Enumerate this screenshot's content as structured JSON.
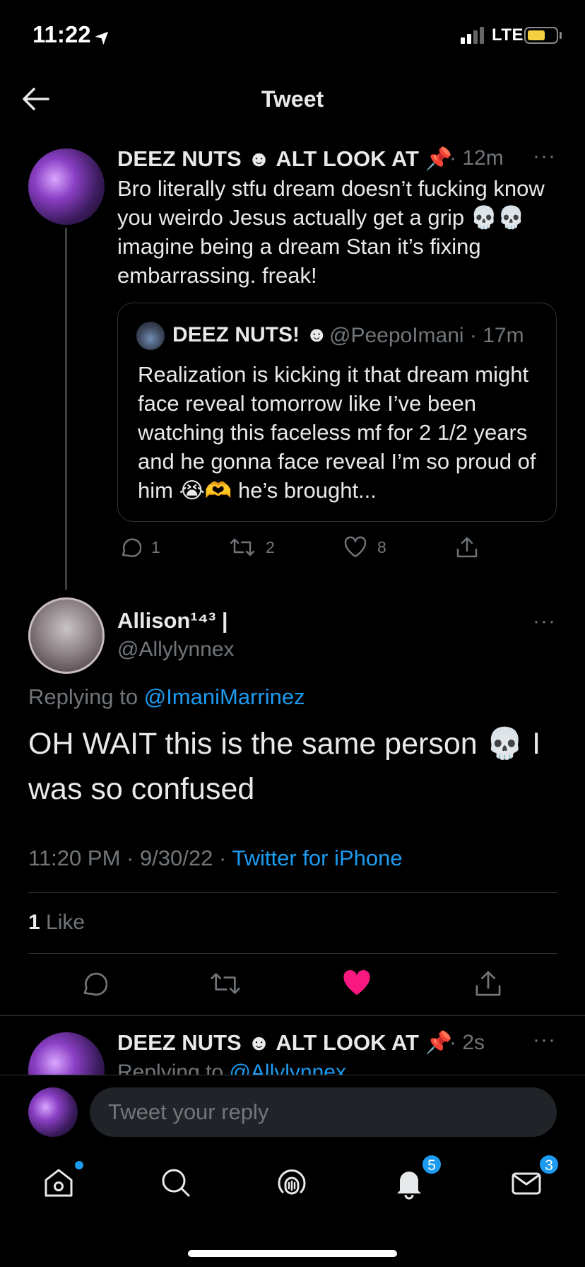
{
  "status": {
    "time": "11:22",
    "network": "LTE"
  },
  "header": {
    "title": "Tweet"
  },
  "parent_tweet": {
    "name": "DEEZ NUTS ☻ ALT LOOK AT 📌",
    "time": "· 12m",
    "more": "···",
    "text": "Bro literally stfu dream doesn’t fucking know you weirdo Jesus actually get a grip 💀💀 imagine being a dream Stan it’s fixing embarrassing. freak!",
    "quote": {
      "name": "DEEZ NUTS! ☻",
      "handle_time": "@PeepoImani · 17m",
      "text": "Realization is kicking it that dream might face reveal tomorrow like I’ve been watching this faceless mf for 2 1/2 years and he gonna face reveal I’m so proud of him 😭🫶 he’s brought..."
    },
    "actions": {
      "replies": "1",
      "retweets": "2",
      "likes": "8"
    }
  },
  "main_tweet": {
    "name": "Allison¹⁴³ |",
    "handle": "@Allylynnex",
    "more": "···",
    "replying_prefix": "Replying to",
    "replying_handle": "@ImaniMarrinez",
    "text": "OH WAIT this is the same person 💀 I was so confused",
    "timestamp": "11:20 PM · 9/30/22 · ",
    "source": "Twitter for iPhone",
    "like_count": "1",
    "like_label": " Like"
  },
  "reply_preview": {
    "name": "DEEZ NUTS ☻ ALT LOOK AT 📌",
    "time": "· 2s",
    "more": "···",
    "replying_prefix": "Replying to",
    "replying_handle": "@Allylynnex"
  },
  "composer": {
    "placeholder": "Tweet your reply"
  },
  "tabbar": {
    "notifications_badge": "5",
    "messages_badge": "3"
  },
  "colors": {
    "accent": "#1d9bf0",
    "like": "#f91880",
    "background": "#000000"
  }
}
